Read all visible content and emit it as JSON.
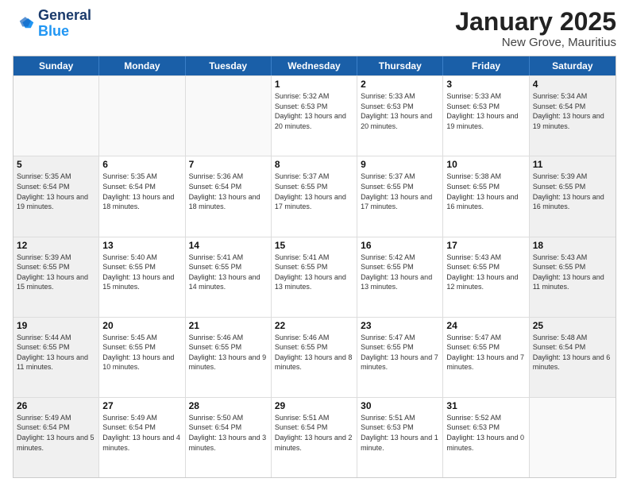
{
  "logo": {
    "line1": "General",
    "line2": "Blue"
  },
  "title": "January 2025",
  "subtitle": "New Grove, Mauritius",
  "days": [
    "Sunday",
    "Monday",
    "Tuesday",
    "Wednesday",
    "Thursday",
    "Friday",
    "Saturday"
  ],
  "weeks": [
    [
      {
        "day": "",
        "info": ""
      },
      {
        "day": "",
        "info": ""
      },
      {
        "day": "",
        "info": ""
      },
      {
        "day": "1",
        "info": "Sunrise: 5:32 AM\nSunset: 6:53 PM\nDaylight: 13 hours\nand 20 minutes."
      },
      {
        "day": "2",
        "info": "Sunrise: 5:33 AM\nSunset: 6:53 PM\nDaylight: 13 hours\nand 20 minutes."
      },
      {
        "day": "3",
        "info": "Sunrise: 5:33 AM\nSunset: 6:53 PM\nDaylight: 13 hours\nand 19 minutes."
      },
      {
        "day": "4",
        "info": "Sunrise: 5:34 AM\nSunset: 6:54 PM\nDaylight: 13 hours\nand 19 minutes."
      }
    ],
    [
      {
        "day": "5",
        "info": "Sunrise: 5:35 AM\nSunset: 6:54 PM\nDaylight: 13 hours\nand 19 minutes."
      },
      {
        "day": "6",
        "info": "Sunrise: 5:35 AM\nSunset: 6:54 PM\nDaylight: 13 hours\nand 18 minutes."
      },
      {
        "day": "7",
        "info": "Sunrise: 5:36 AM\nSunset: 6:54 PM\nDaylight: 13 hours\nand 18 minutes."
      },
      {
        "day": "8",
        "info": "Sunrise: 5:37 AM\nSunset: 6:55 PM\nDaylight: 13 hours\nand 17 minutes."
      },
      {
        "day": "9",
        "info": "Sunrise: 5:37 AM\nSunset: 6:55 PM\nDaylight: 13 hours\nand 17 minutes."
      },
      {
        "day": "10",
        "info": "Sunrise: 5:38 AM\nSunset: 6:55 PM\nDaylight: 13 hours\nand 16 minutes."
      },
      {
        "day": "11",
        "info": "Sunrise: 5:39 AM\nSunset: 6:55 PM\nDaylight: 13 hours\nand 16 minutes."
      }
    ],
    [
      {
        "day": "12",
        "info": "Sunrise: 5:39 AM\nSunset: 6:55 PM\nDaylight: 13 hours\nand 15 minutes."
      },
      {
        "day": "13",
        "info": "Sunrise: 5:40 AM\nSunset: 6:55 PM\nDaylight: 13 hours\nand 15 minutes."
      },
      {
        "day": "14",
        "info": "Sunrise: 5:41 AM\nSunset: 6:55 PM\nDaylight: 13 hours\nand 14 minutes."
      },
      {
        "day": "15",
        "info": "Sunrise: 5:41 AM\nSunset: 6:55 PM\nDaylight: 13 hours\nand 13 minutes."
      },
      {
        "day": "16",
        "info": "Sunrise: 5:42 AM\nSunset: 6:55 PM\nDaylight: 13 hours\nand 13 minutes."
      },
      {
        "day": "17",
        "info": "Sunrise: 5:43 AM\nSunset: 6:55 PM\nDaylight: 13 hours\nand 12 minutes."
      },
      {
        "day": "18",
        "info": "Sunrise: 5:43 AM\nSunset: 6:55 PM\nDaylight: 13 hours\nand 11 minutes."
      }
    ],
    [
      {
        "day": "19",
        "info": "Sunrise: 5:44 AM\nSunset: 6:55 PM\nDaylight: 13 hours\nand 11 minutes."
      },
      {
        "day": "20",
        "info": "Sunrise: 5:45 AM\nSunset: 6:55 PM\nDaylight: 13 hours\nand 10 minutes."
      },
      {
        "day": "21",
        "info": "Sunrise: 5:46 AM\nSunset: 6:55 PM\nDaylight: 13 hours\nand 9 minutes."
      },
      {
        "day": "22",
        "info": "Sunrise: 5:46 AM\nSunset: 6:55 PM\nDaylight: 13 hours\nand 8 minutes."
      },
      {
        "day": "23",
        "info": "Sunrise: 5:47 AM\nSunset: 6:55 PM\nDaylight: 13 hours\nand 7 minutes."
      },
      {
        "day": "24",
        "info": "Sunrise: 5:47 AM\nSunset: 6:55 PM\nDaylight: 13 hours\nand 7 minutes."
      },
      {
        "day": "25",
        "info": "Sunrise: 5:48 AM\nSunset: 6:54 PM\nDaylight: 13 hours\nand 6 minutes."
      }
    ],
    [
      {
        "day": "26",
        "info": "Sunrise: 5:49 AM\nSunset: 6:54 PM\nDaylight: 13 hours\nand 5 minutes."
      },
      {
        "day": "27",
        "info": "Sunrise: 5:49 AM\nSunset: 6:54 PM\nDaylight: 13 hours\nand 4 minutes."
      },
      {
        "day": "28",
        "info": "Sunrise: 5:50 AM\nSunset: 6:54 PM\nDaylight: 13 hours\nand 3 minutes."
      },
      {
        "day": "29",
        "info": "Sunrise: 5:51 AM\nSunset: 6:54 PM\nDaylight: 13 hours\nand 2 minutes."
      },
      {
        "day": "30",
        "info": "Sunrise: 5:51 AM\nSunset: 6:53 PM\nDaylight: 13 hours\nand 1 minute."
      },
      {
        "day": "31",
        "info": "Sunrise: 5:52 AM\nSunset: 6:53 PM\nDaylight: 13 hours\nand 0 minutes."
      },
      {
        "day": "",
        "info": ""
      }
    ]
  ]
}
